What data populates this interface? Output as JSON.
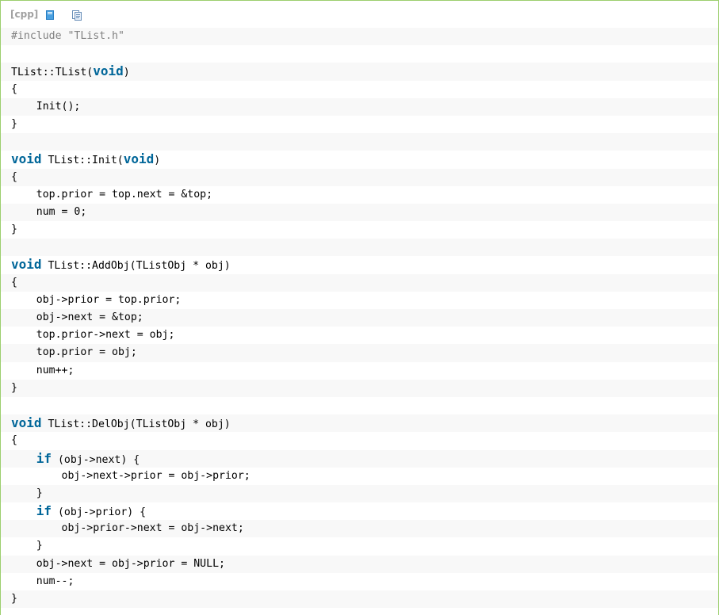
{
  "toolbar": {
    "lang": "[cpp]",
    "icons": [
      "view-plain-icon",
      "copy-icon"
    ]
  },
  "code_lines": [
    [
      {
        "t": "pp",
        "v": "#include \"TList.h\""
      }
    ],
    [],
    [
      {
        "t": "n",
        "v": "TList::TList("
      },
      {
        "t": "kw",
        "v": "void"
      },
      {
        "t": "n",
        "v": ")"
      }
    ],
    [
      {
        "t": "n",
        "v": "{"
      }
    ],
    [
      {
        "t": "n",
        "v": "    Init();"
      }
    ],
    [
      {
        "t": "n",
        "v": "}"
      }
    ],
    [],
    [
      {
        "t": "kw",
        "v": "void"
      },
      {
        "t": "n",
        "v": " TList::Init("
      },
      {
        "t": "kw",
        "v": "void"
      },
      {
        "t": "n",
        "v": ")"
      }
    ],
    [
      {
        "t": "n",
        "v": "{"
      }
    ],
    [
      {
        "t": "n",
        "v": "    top.prior = top.next = &top;"
      }
    ],
    [
      {
        "t": "n",
        "v": "    num = 0;"
      }
    ],
    [
      {
        "t": "n",
        "v": "}"
      }
    ],
    [],
    [
      {
        "t": "kw",
        "v": "void"
      },
      {
        "t": "n",
        "v": " TList::AddObj(TListObj * obj)"
      }
    ],
    [
      {
        "t": "n",
        "v": "{"
      }
    ],
    [
      {
        "t": "n",
        "v": "    obj->prior = top.prior;"
      }
    ],
    [
      {
        "t": "n",
        "v": "    obj->next = &top;"
      }
    ],
    [
      {
        "t": "n",
        "v": "    top.prior->next = obj;"
      }
    ],
    [
      {
        "t": "n",
        "v": "    top.prior = obj;"
      }
    ],
    [
      {
        "t": "n",
        "v": "    num++;"
      }
    ],
    [
      {
        "t": "n",
        "v": "}"
      }
    ],
    [],
    [
      {
        "t": "kw",
        "v": "void"
      },
      {
        "t": "n",
        "v": " TList::DelObj(TListObj * obj)"
      }
    ],
    [
      {
        "t": "n",
        "v": "{"
      }
    ],
    [
      {
        "t": "n",
        "v": "    "
      },
      {
        "t": "kw",
        "v": "if"
      },
      {
        "t": "n",
        "v": " (obj->next) {"
      }
    ],
    [
      {
        "t": "n",
        "v": "        obj->next->prior = obj->prior;"
      }
    ],
    [
      {
        "t": "n",
        "v": "    }"
      }
    ],
    [
      {
        "t": "n",
        "v": "    "
      },
      {
        "t": "kw",
        "v": "if"
      },
      {
        "t": "n",
        "v": " (obj->prior) {"
      }
    ],
    [
      {
        "t": "n",
        "v": "        obj->prior->next = obj->next;"
      }
    ],
    [
      {
        "t": "n",
        "v": "    }"
      }
    ],
    [
      {
        "t": "n",
        "v": "    obj->next = obj->prior = NULL;"
      }
    ],
    [
      {
        "t": "n",
        "v": "    num--;"
      }
    ],
    [
      {
        "t": "n",
        "v": "}"
      }
    ],
    []
  ],
  "colors": {
    "keyword": "#006699",
    "preprocessor": "#808080",
    "border": "#9ccf6e",
    "odd_row": "#f8f8f8"
  }
}
